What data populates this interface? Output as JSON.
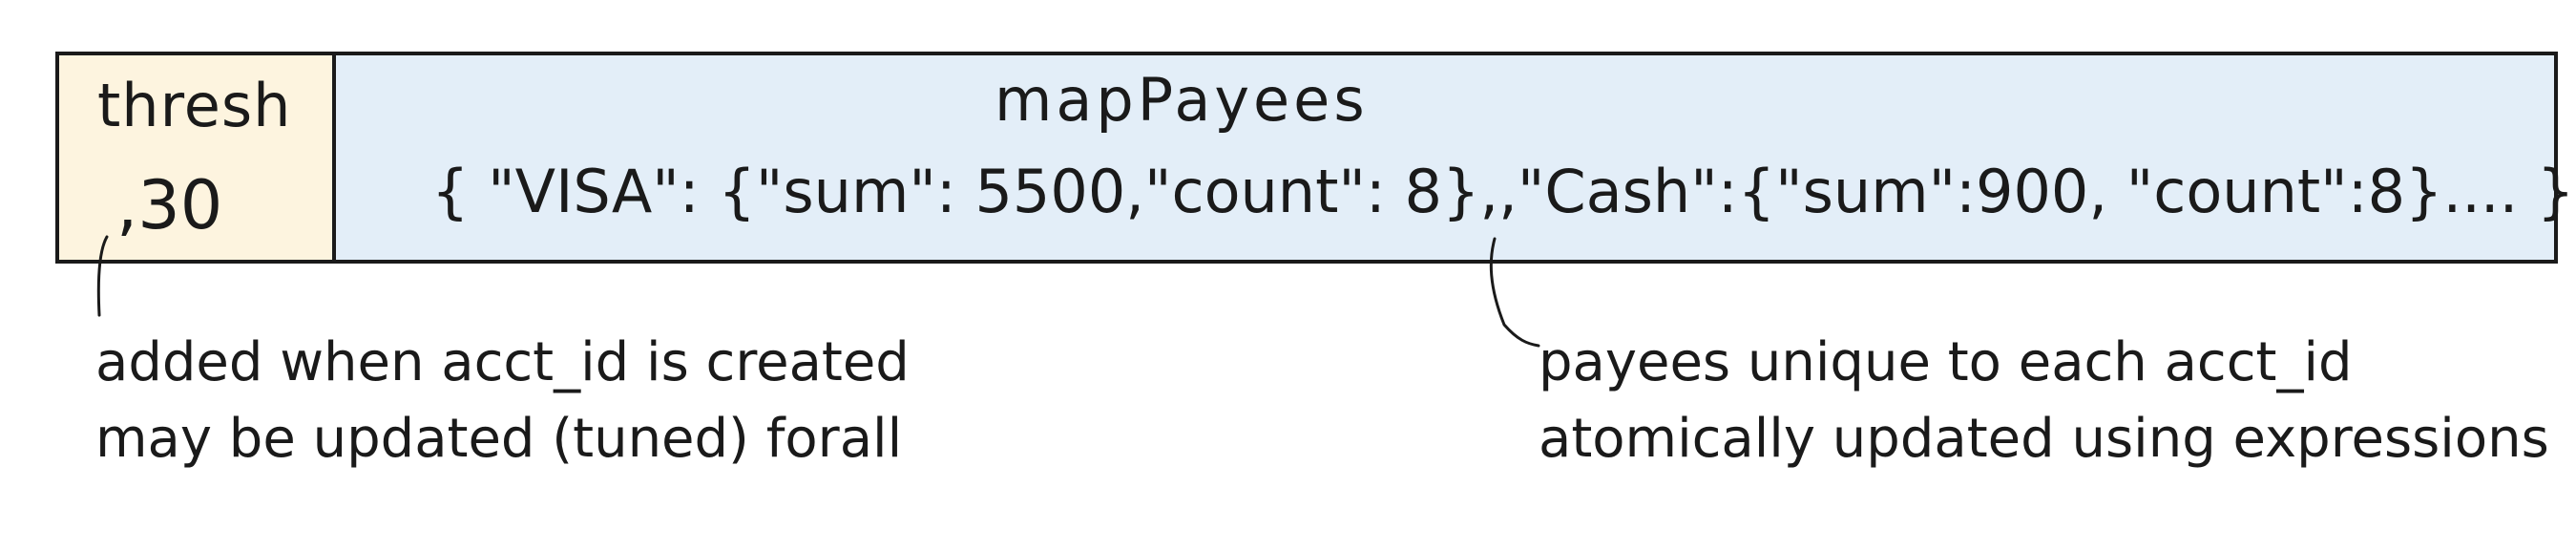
{
  "record": {
    "thresh_bin": {
      "name": "thresh",
      "value": ",30",
      "fill_color": "#fdf4df"
    },
    "map_bin": {
      "name": "mapPayees",
      "value": "{ \"VISA\": {\"sum\": 5500,\"count\": 8},,\"Cash\":{\"sum\":900, \"count\":8}.... }",
      "fill_color": "#e3eef8"
    }
  },
  "annotations": {
    "thresh_note": {
      "line1": "added when acct_id is created",
      "line2": "may be updated (tuned) forall"
    },
    "payees_note": {
      "line1": "payees unique to each acct_id",
      "line2": "atomically updated using expressions"
    }
  }
}
